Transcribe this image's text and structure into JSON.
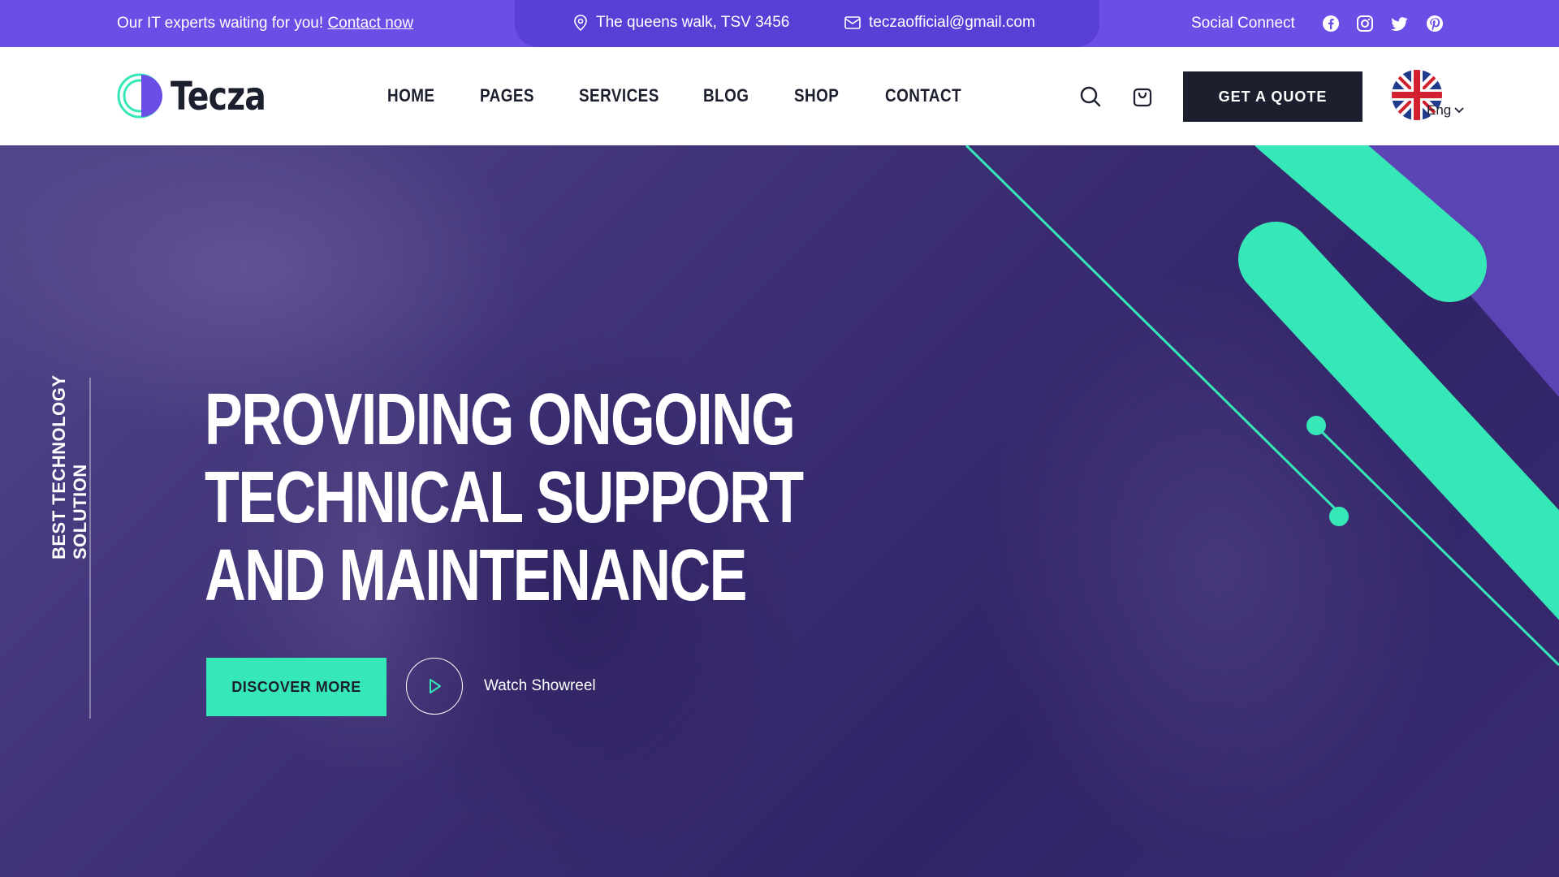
{
  "topbar": {
    "message": "Our IT experts waiting for you!",
    "contact_link": "Contact now",
    "address": "The queens walk, TSV 3456",
    "email": "teczaofficial@gmail.com",
    "social_label": "Social Connect",
    "social_icons": [
      "facebook-icon",
      "instagram-icon",
      "twitter-icon",
      "pinterest-icon"
    ]
  },
  "brand": {
    "name": "Tecza",
    "accent": "#36e8b8",
    "primary": "#6c4ee6",
    "dark": "#1b1f2e"
  },
  "nav": {
    "items": [
      "HOME",
      "PAGES",
      "SERVICES",
      "BLOG",
      "SHOP",
      "CONTACT"
    ],
    "quote_button": "GET A QUOTE",
    "language": "Eng"
  },
  "hero": {
    "tagline": "BEST TECHNOLOGY SOLUTION",
    "headline_lines": [
      "PROVIDING ONGOING",
      "TECHNICAL SUPPORT",
      "AND MAINTENANCE"
    ],
    "primary_button": "DISCOVER MORE",
    "secondary_link": "Watch Showreel"
  }
}
